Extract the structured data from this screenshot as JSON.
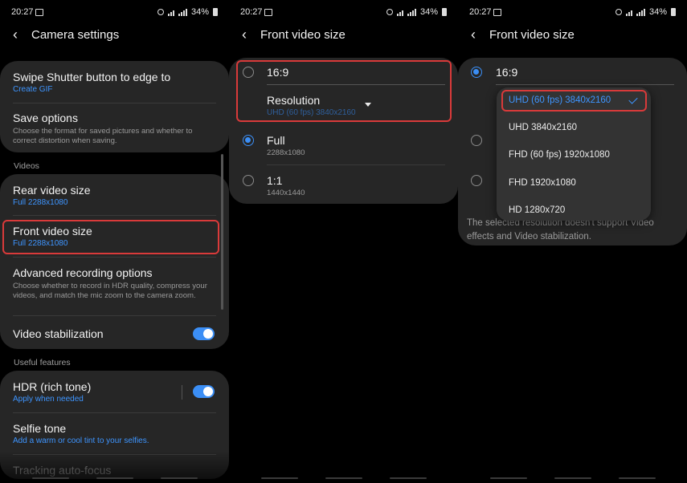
{
  "status": {
    "time": "20:27",
    "battery": "34%"
  },
  "camera_settings": {
    "title": "Camera settings",
    "swipe_shutter": {
      "title": "Swipe Shutter button to edge to",
      "value": "Create GIF"
    },
    "save_options": {
      "title": "Save options",
      "desc": "Choose the format for saved pictures and whether to correct distortion when saving."
    },
    "videos_header": "Videos",
    "rear_video_size": {
      "title": "Rear video size",
      "value": "Full 2288x1080"
    },
    "front_video_size": {
      "title": "Front video size",
      "value": "Full 2288x1080"
    },
    "advanced_recording": {
      "title": "Advanced recording options",
      "desc": "Choose whether to record in HDR quality, compress your videos, and match the mic zoom to the camera zoom."
    },
    "video_stabilization": {
      "title": "Video stabilization",
      "enabled": true
    },
    "useful_header": "Useful features",
    "hdr": {
      "title": "HDR (rich tone)",
      "value": "Apply when needed",
      "enabled": true
    },
    "selfie_tone": {
      "title": "Selfie tone",
      "value": "Add a warm or cool tint to your selfies."
    },
    "tracking_af": {
      "title": "Tracking auto-focus"
    }
  },
  "front_video": {
    "title": "Front video size",
    "options": [
      {
        "label": "16:9",
        "selected": false
      },
      {
        "label": "Full",
        "sub": "2288x1080",
        "selected": true
      },
      {
        "label": "1:1",
        "sub": "1440x1440",
        "selected": false
      }
    ],
    "resolution_label": "Resolution",
    "resolution_value": "UHD (60 fps) 3840x2160"
  },
  "front_video_dropdown": {
    "title": "Front video size",
    "option_169": "16:9",
    "dropdown_options": [
      {
        "label": "UHD (60 fps) 3840x2160",
        "selected": true
      },
      {
        "label": "UHD 3840x2160",
        "selected": false
      },
      {
        "label": "FHD (60 fps) 1920x1080",
        "selected": false
      },
      {
        "label": "FHD 1920x1080",
        "selected": false
      },
      {
        "label": "HD 1280x720",
        "selected": false
      }
    ],
    "note_visible": "The selected resolution doesn't support Video effects and Video stabilization."
  },
  "colors": {
    "accent": "#3e95ff",
    "card": "#262626",
    "highlight": "#d93a3a"
  }
}
